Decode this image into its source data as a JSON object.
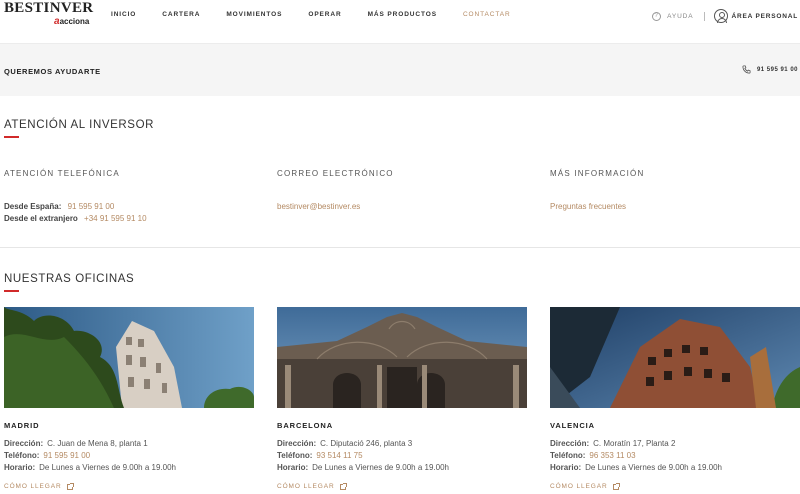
{
  "header": {
    "logo_main": "BESTINVER",
    "logo_sub_brand": "acciona",
    "logo_sub_initial": "a",
    "nav": [
      "INICIO",
      "CARTERA",
      "MOVIMIENTOS",
      "OPERAR",
      "MÁS PRODUCTOS",
      "CONTACTAR"
    ],
    "active_nav": "CONTACTAR",
    "help_label": "AYUDA",
    "account_label": "ÁREA PERSONAL"
  },
  "band": {
    "title": "QUEREMOS AYUDARTE",
    "phone": "91 595 91 00"
  },
  "investor": {
    "title": "ATENCIÓN AL INVERSOR",
    "phone_col": {
      "heading": "ATENCIÓN TELEFÓNICA",
      "spain_label": "Desde España:",
      "spain_value": "91 595 91 00",
      "abroad_label": "Desde el extranjero",
      "abroad_value": "+34 91 595 91 10"
    },
    "email_col": {
      "heading": "CORREO ELECTRÓNICO",
      "email": "bestinver@bestinver.es"
    },
    "info_col": {
      "heading": "MÁS INFORMACIÓN",
      "link": "Preguntas frecuentes"
    }
  },
  "offices": {
    "title": "NUESTRAS OFICINAS",
    "address_label": "Dirección:",
    "phone_label": "Teléfono:",
    "hours_label": "Horario:",
    "howto_label": "CÓMO LLEGAR",
    "items": [
      {
        "city": "MADRID",
        "address": "C. Juan de Mena 8, planta 1",
        "phone": "91 595 91 00",
        "hours": "De Lunes a Viernes de 9.00h a 19.00h"
      },
      {
        "city": "BARCELONA",
        "address": "C. Diputació 246, planta 3",
        "phone": "93 514 11 75",
        "hours": "De Lunes a Viernes de 9.00h a 19.00h"
      },
      {
        "city": "VALENCIA",
        "address": "C. Moratín 17, Planta 2",
        "phone": "96 353 11 03",
        "hours": "De Lunes a Viernes de 9.00h a 19.00h"
      }
    ]
  },
  "colors": {
    "accent": "#b48a63",
    "brand_red": "#d12a2a",
    "band_bg": "#f5f5f5"
  }
}
